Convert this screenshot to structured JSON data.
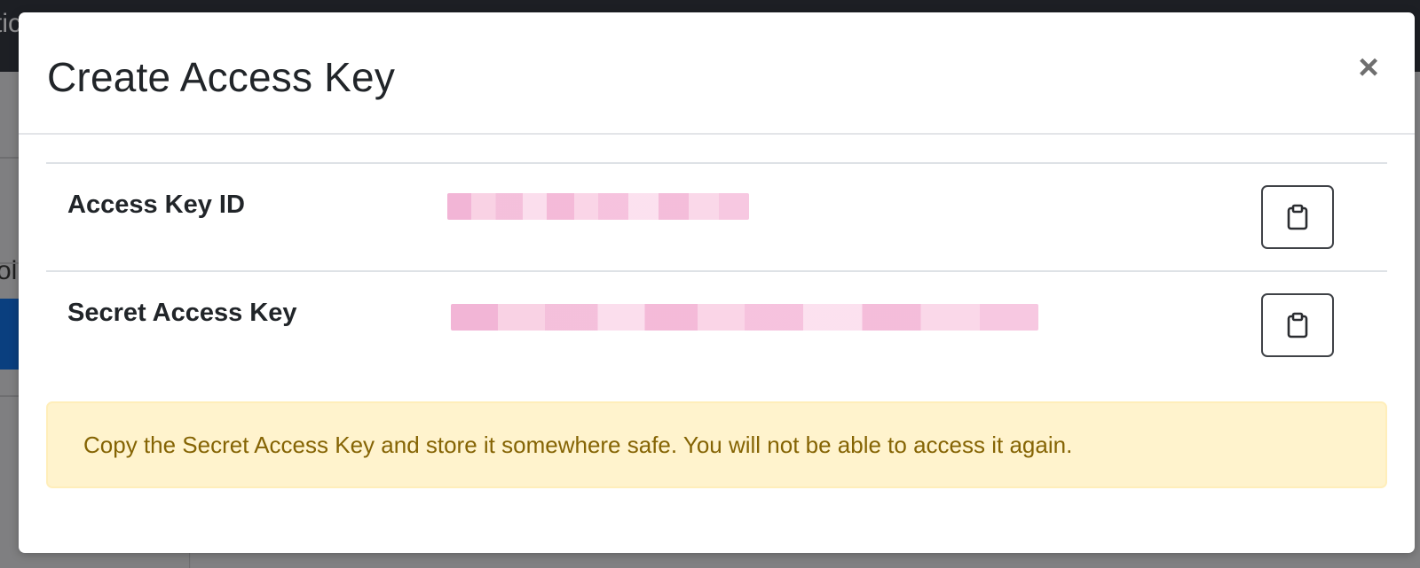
{
  "background": {
    "topbar_text": "tic",
    "sidebar_text": "ol"
  },
  "modal": {
    "title": "Create Access Key",
    "close_symbol": "×",
    "rows": [
      {
        "label": "Access Key ID",
        "value": "",
        "value_redacted": true,
        "copy_icon": "clipboard-icon"
      },
      {
        "label": "Secret Access Key",
        "value": "",
        "value_redacted": true,
        "copy_icon": "clipboard-icon"
      }
    ],
    "alert": "Copy the Secret Access Key and store it somewhere safe. You will not be able to access it again."
  },
  "colors": {
    "alert_background": "#fff3cd",
    "alert_text": "#856404",
    "backdrop": "#7d7d7f",
    "redaction": "#f0a0c8"
  }
}
